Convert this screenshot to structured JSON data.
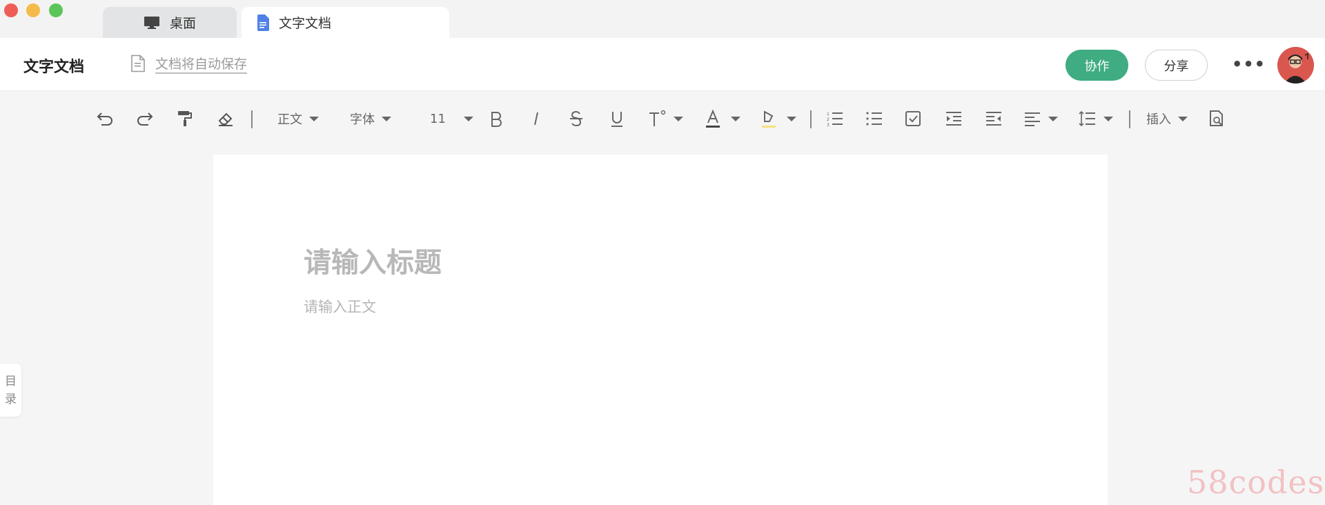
{
  "window": {
    "traffic_lights": {
      "close": "#ee5e57",
      "minimize": "#f5bb4a",
      "maximize": "#5bc55a"
    },
    "tabs": [
      {
        "label": "桌面",
        "icon": "monitor-icon"
      },
      {
        "label": "文字文档",
        "icon": "document-icon",
        "active": true
      }
    ]
  },
  "header": {
    "title": "文字文档",
    "autosave_label": "文档将自动保存",
    "collab_button": "协作",
    "share_button": "分享",
    "more_label": "•••"
  },
  "toolbar": {
    "paragraph_style": "正文",
    "font": "字体",
    "font_size": "11",
    "insert_label": "插入",
    "items": [
      "undo-icon",
      "redo-icon",
      "format-painter-icon",
      "eraser-icon",
      "bold-icon",
      "italic-icon",
      "strikethrough-icon",
      "underline-icon",
      "superscript-icon",
      "font-color-icon",
      "highlight-icon",
      "ordered-list-icon",
      "bullet-list-icon",
      "checkbox-list-icon",
      "indent-icon",
      "outdent-icon",
      "align-icon",
      "line-spacing-icon",
      "search-doc-icon"
    ]
  },
  "editor": {
    "title_placeholder": "请输入标题",
    "body_placeholder": "请输入正文"
  },
  "outline_tab": {
    "char1": "目",
    "char2": "录"
  },
  "watermark": "58codes",
  "colors": {
    "accent": "#3fac82",
    "background": "#f5f5f5",
    "page": "#ffffff"
  }
}
